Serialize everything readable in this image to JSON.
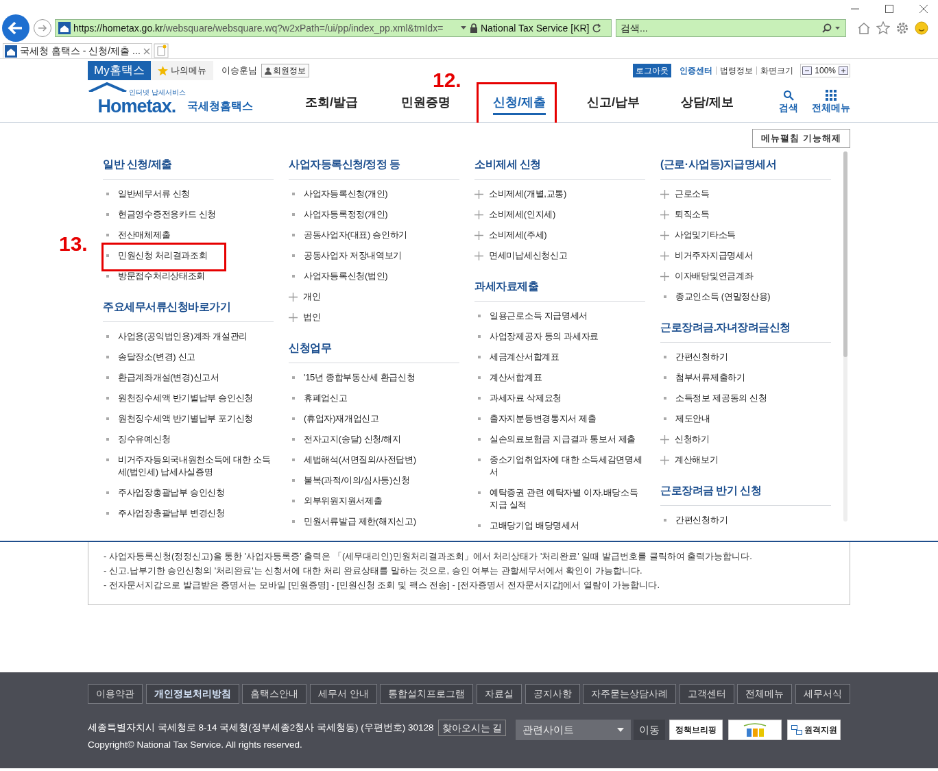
{
  "browser": {
    "url_host": "https://hometax.go.kr",
    "url_path": "/websquare/websquare.wq?w2xPath=/ui/pp/index_pp.xml&tmIdx=",
    "site_identity": "National Tax Service [KR]",
    "search_placeholder": "검색...",
    "tabs": [
      {
        "label": "국세청 홈택스 - 신청/제출 ...",
        "selected": true
      }
    ]
  },
  "util_bar": {
    "my_hometax": "My홈택스",
    "my_menu": "나의메뉴",
    "user": "이승훈님",
    "member_info": "회원정보",
    "logout": "로그아웃",
    "links": [
      {
        "label": "인증센터",
        "emphasized": true
      },
      {
        "label": "법령정보",
        "emphasized": false
      },
      {
        "label": "화면크기",
        "emphasized": false
      }
    ],
    "zoom": "100%"
  },
  "header": {
    "logo_tagline": "인터넷 납세서비스",
    "logo_text": "Hometax.",
    "logo_subtitle": "국세청홈택스",
    "nav": [
      {
        "label": "조회/발급",
        "selected": false
      },
      {
        "label": "민원증명",
        "selected": false
      },
      {
        "label": "신청/제출",
        "selected": true,
        "annotation": "12."
      },
      {
        "label": "신고/납부",
        "selected": false
      },
      {
        "label": "상담/제보",
        "selected": false
      }
    ],
    "search": "검색",
    "all_menu": "전체메뉴"
  },
  "menu": {
    "collapse_button": "메뉴펼침 기능해제",
    "columns": [
      [
        {
          "title": "일반 신청/제출",
          "items": [
            {
              "label": "일반세무서류 신청",
              "kind": "bullet"
            },
            {
              "label": "현금영수증전용카드 신청",
              "kind": "bullet"
            },
            {
              "label": "전산매체제출",
              "kind": "bullet"
            },
            {
              "label": "민원신청 처리결과조회",
              "kind": "bullet",
              "annotation": "13."
            },
            {
              "label": "방문접수처리상태조회",
              "kind": "bullet"
            }
          ]
        },
        {
          "title": "주요세무서류신청바로가기",
          "items": [
            {
              "label": "사업용(공익법인용)계좌 개설관리",
              "kind": "bullet"
            },
            {
              "label": "송달장소(변경) 신고",
              "kind": "bullet"
            },
            {
              "label": "환급계좌개설(변경)신고서",
              "kind": "bullet"
            },
            {
              "label": "원천징수세액 반기별납부 승인신청",
              "kind": "bullet"
            },
            {
              "label": "원천징수세액 반기별납부 포기신청",
              "kind": "bullet"
            },
            {
              "label": "징수유예신청",
              "kind": "bullet"
            },
            {
              "label": "비거주자등의국내원천소득에 대한 소득세(법인세) 납세사실증명",
              "kind": "bullet"
            },
            {
              "label": "주사업장총괄납부 승인신청",
              "kind": "bullet"
            },
            {
              "label": "주사업장총괄납부 변경신청",
              "kind": "bullet"
            }
          ]
        }
      ],
      [
        {
          "title": "사업자등록신청/정정 등",
          "items": [
            {
              "label": "사업자등록신청(개인)",
              "kind": "bullet"
            },
            {
              "label": "사업자등록정정(개인)",
              "kind": "bullet"
            },
            {
              "label": "공동사업자(대표) 승인하기",
              "kind": "bullet"
            },
            {
              "label": "공동사업자 저장내역보기",
              "kind": "bullet"
            },
            {
              "label": "사업자등록신청(법인)",
              "kind": "bullet"
            },
            {
              "label": "개인",
              "kind": "plus"
            },
            {
              "label": "법인",
              "kind": "plus"
            }
          ]
        },
        {
          "title": "신청업무",
          "items": [
            {
              "label": "'15년 종합부동산세 환급신청",
              "kind": "bullet"
            },
            {
              "label": "휴폐업신고",
              "kind": "bullet"
            },
            {
              "label": "(휴업자)재개업신고",
              "kind": "bullet"
            },
            {
              "label": "전자고지(송달) 신청/해지",
              "kind": "bullet"
            },
            {
              "label": "세법해석(서면질의/사전답변)",
              "kind": "bullet"
            },
            {
              "label": "불복(과적/이의/심사등)신청",
              "kind": "bullet"
            },
            {
              "label": "외부위원지원서제출",
              "kind": "bullet"
            },
            {
              "label": "민원서류발급 제한(해지신고)",
              "kind": "bullet"
            }
          ]
        }
      ],
      [
        {
          "title": "소비제세 신청",
          "items": [
            {
              "label": "소비제세(개별,교통)",
              "kind": "plus"
            },
            {
              "label": "소비제세(인지세)",
              "kind": "plus"
            },
            {
              "label": "소비제세(주세)",
              "kind": "plus"
            },
            {
              "label": "면세미납세신청신고",
              "kind": "plus"
            }
          ]
        },
        {
          "title": "과세자료제출",
          "items": [
            {
              "label": "일용근로소득 지급명세서",
              "kind": "bullet"
            },
            {
              "label": "사업장제공자 등의 과세자료",
              "kind": "bullet"
            },
            {
              "label": "세금계산서합계표",
              "kind": "bullet"
            },
            {
              "label": "계산서합계표",
              "kind": "bullet"
            },
            {
              "label": "과세자료 삭제요청",
              "kind": "bullet"
            },
            {
              "label": "출자지분등변경통지서 제출",
              "kind": "bullet"
            },
            {
              "label": "실손의료보험금 지급결과 통보서 제출",
              "kind": "bullet"
            },
            {
              "label": "중소기업취업자에 대한 소득세감면명세서",
              "kind": "bullet"
            },
            {
              "label": "예탁증권 관련 예탁자별 이자.배당소득 지급 실적",
              "kind": "bullet"
            },
            {
              "label": "고배당기업 배당명세서",
              "kind": "bullet"
            }
          ]
        }
      ],
      [
        {
          "title": "(근로·사업등)지급명세서",
          "items": [
            {
              "label": "근로소득",
              "kind": "plus"
            },
            {
              "label": "퇴직소득",
              "kind": "plus"
            },
            {
              "label": "사업및기타소득",
              "kind": "plus"
            },
            {
              "label": "비거주자지급명세서",
              "kind": "plus"
            },
            {
              "label": "이자배당및연금계좌",
              "kind": "plus"
            },
            {
              "label": "종교인소득 (연말정산용)",
              "kind": "bullet"
            }
          ]
        },
        {
          "title": "근로장려금.자녀장려금신청",
          "items": [
            {
              "label": "간편신청하기",
              "kind": "bullet"
            },
            {
              "label": "첨부서류제출하기",
              "kind": "bullet"
            },
            {
              "label": "소득정보 제공동의 신청",
              "kind": "bullet"
            },
            {
              "label": "제도안내",
              "kind": "bullet"
            },
            {
              "label": "신청하기",
              "kind": "plus"
            },
            {
              "label": "계산해보기",
              "kind": "plus"
            }
          ]
        },
        {
          "title": "근로장려금 반기 신청",
          "items": [
            {
              "label": "간편신청하기",
              "kind": "bullet"
            }
          ]
        }
      ]
    ]
  },
  "notes": [
    "- 사업자등록신청(정정신고)을 통한 '사업자등록증' 출력은 「(세무대리인)민원처리결과조회」에서 처리상태가 '처리완료' 일때 발급번호를 클릭하여 출력가능합니다.",
    "- 신고.납부기한 승인신청의 '처리완료'는 신청서에 대한 처리 완료상태를 말하는 것으로, 승인 여부는 관할세무서에서 확인이 가능합니다.",
    "- 전자문서지갑으로 발급받은 증명서는 모바일 [민원증명] - [민원신청 조회 및 팩스 전송] - [전자증명서 전자문서지갑]에서 열람이 가능합니다."
  ],
  "footer": {
    "links": [
      {
        "label": "이용약관",
        "emphasized": false
      },
      {
        "label": "개인정보처리방침",
        "emphasized": true
      },
      {
        "label": "홈택스안내",
        "emphasized": false
      },
      {
        "label": "세무서 안내",
        "emphasized": false
      },
      {
        "label": "통합설치프로그램",
        "emphasized": false
      },
      {
        "label": "자료실",
        "emphasized": false
      },
      {
        "label": "공지사항",
        "emphasized": false
      },
      {
        "label": "자주묻는상담사례",
        "emphasized": false
      },
      {
        "label": "고객센터",
        "emphasized": false
      },
      {
        "label": "전체메뉴",
        "emphasized": false
      },
      {
        "label": "세무서식",
        "emphasized": false
      }
    ],
    "address": "세종특별자치시 국세청로 8-14 국세청(정부세종2청사 국세청동) (우편번호) 30128",
    "directions": "찾아오시는 길",
    "copyright": "Copyright© National Tax Service. All rights reserved.",
    "related_sites": "관련사이트",
    "go": "이동",
    "banners": [
      {
        "label": "정책브리핑",
        "kind": "text"
      },
      {
        "kind": "callcenter"
      },
      {
        "label": "원격지원",
        "kind": "remote"
      }
    ]
  }
}
